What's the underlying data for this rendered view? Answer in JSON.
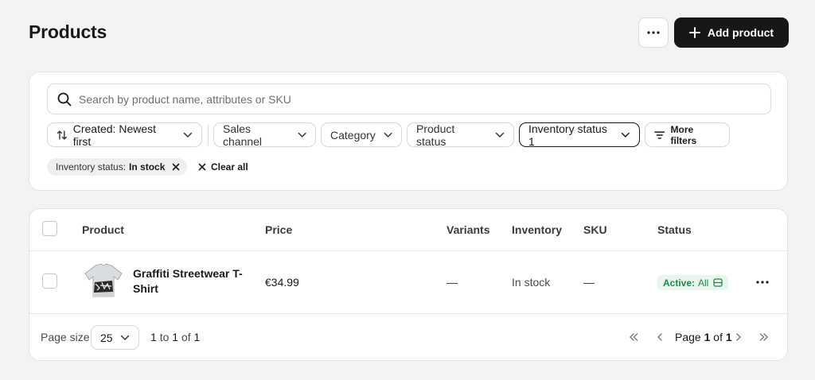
{
  "header": {
    "title": "Products",
    "add_button_label": "Add product"
  },
  "filters": {
    "search_placeholder": "Search by product name, attributes or SKU",
    "sort_label": "Created: Newest first",
    "chips": [
      {
        "label": "Sales channel"
      },
      {
        "label": "Category"
      },
      {
        "label": "Product status"
      },
      {
        "label": "Inventory status 1",
        "active": true
      }
    ],
    "more_filters_label": "More filters",
    "applied_tag": {
      "prefix": "Inventory status:",
      "value": "In stock"
    },
    "clear_all_label": "Clear all"
  },
  "table": {
    "columns": [
      "Product",
      "Price",
      "Variants",
      "Inventory",
      "SKU",
      "Status"
    ],
    "rows": [
      {
        "name": "Graffiti Streetwear T-Shirt",
        "price": "€34.99",
        "variants": "—",
        "inventory": "In stock",
        "sku": "—",
        "status_label": "Active:",
        "status_value": "All"
      }
    ]
  },
  "pagination": {
    "page_size_label": "Page size",
    "page_size": "25",
    "range_text_parts": [
      "1",
      "to",
      "1",
      "of",
      "1"
    ],
    "page_text_parts": [
      "Page",
      "1",
      "of",
      "1"
    ]
  },
  "icons": {
    "more": "more-horizontal-icon",
    "plus": "plus-icon",
    "search": "search-icon",
    "sort": "sort-arrows-icon",
    "chevron": "chevron-down-icon",
    "filter": "filter-lines-icon",
    "close": "close-icon",
    "channel": "channel-icon"
  },
  "colors": {
    "primary_button": "#171717",
    "status_active_bg": "#e8f6ee",
    "status_active_text": "#1f8a4d",
    "page_background": "#f3f3f3"
  }
}
